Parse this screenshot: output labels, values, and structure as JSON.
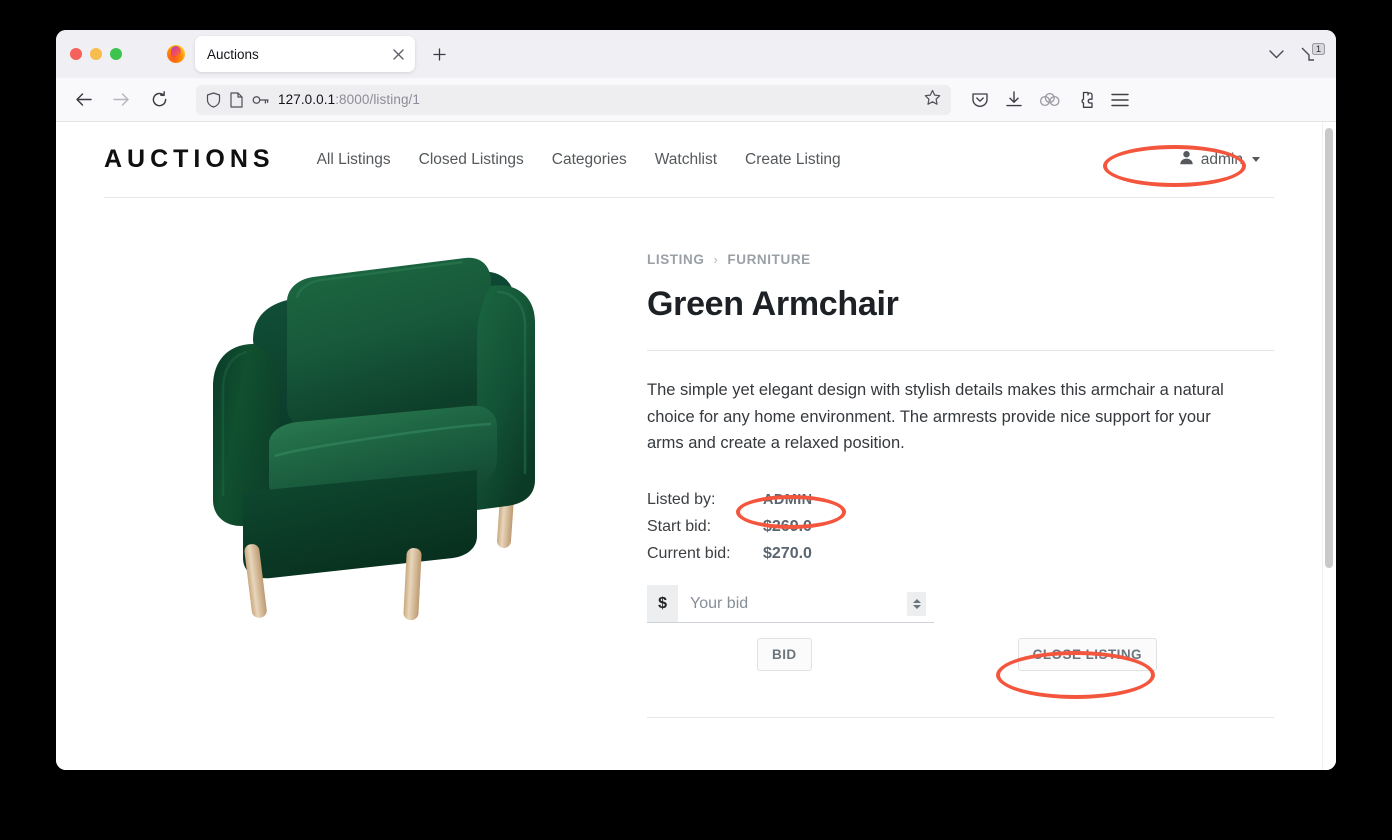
{
  "browser": {
    "tab_title": "Auctions",
    "tab_close_icon": "close-icon",
    "new_tab_icon": "plus-icon",
    "all_tabs_badge": "1",
    "url_host": "127.0.0.1",
    "url_path": ":8000/listing/1",
    "icons": {
      "back": "back-arrow-icon",
      "forward": "forward-arrow-icon",
      "reload": "reload-icon",
      "shield": "shield-icon",
      "page": "page-icon",
      "key": "key-icon",
      "star": "bookmark-star-icon",
      "pocket": "pocket-save-icon",
      "download": "download-icon",
      "containers": "container-tabs-icon",
      "extensions": "extensions-icon",
      "menu": "hamburger-menu-icon"
    }
  },
  "site": {
    "brand": "AUCTIONS",
    "nav_links": [
      {
        "label": "All Listings"
      },
      {
        "label": "Closed Listings"
      },
      {
        "label": "Categories"
      },
      {
        "label": "Watchlist"
      },
      {
        "label": "Create Listing"
      }
    ],
    "user_menu": {
      "username": "admin",
      "user_icon": "person-icon",
      "caret_icon": "chevron-down-icon"
    }
  },
  "listing": {
    "breadcrumb": {
      "root": "LISTING",
      "separator": "›",
      "category": "FURNITURE"
    },
    "title": "Green Armchair",
    "description": "The simple yet elegant design with stylish details makes this armchair a natural choice for any home environment. The armrests provide nice support for your arms and create a relaxed position.",
    "image_alt": "green-armchair-photo",
    "details": [
      {
        "label": "Listed by:",
        "value": "ADMIN"
      },
      {
        "label": "Start bid:",
        "value": "$269.0"
      },
      {
        "label": "Current bid:",
        "value": "$270.0"
      }
    ],
    "bid_form": {
      "currency_prefix": "$",
      "placeholder": "Your bid",
      "value": "",
      "spinner_icon": "number-spinner-icon"
    },
    "buttons": {
      "bid": "BID",
      "close_listing": "CLOSE LISTING"
    }
  },
  "annotations": {
    "color": "#f4553d",
    "targets": [
      "user-menu",
      "listed-by-value",
      "close-listing-button"
    ]
  }
}
